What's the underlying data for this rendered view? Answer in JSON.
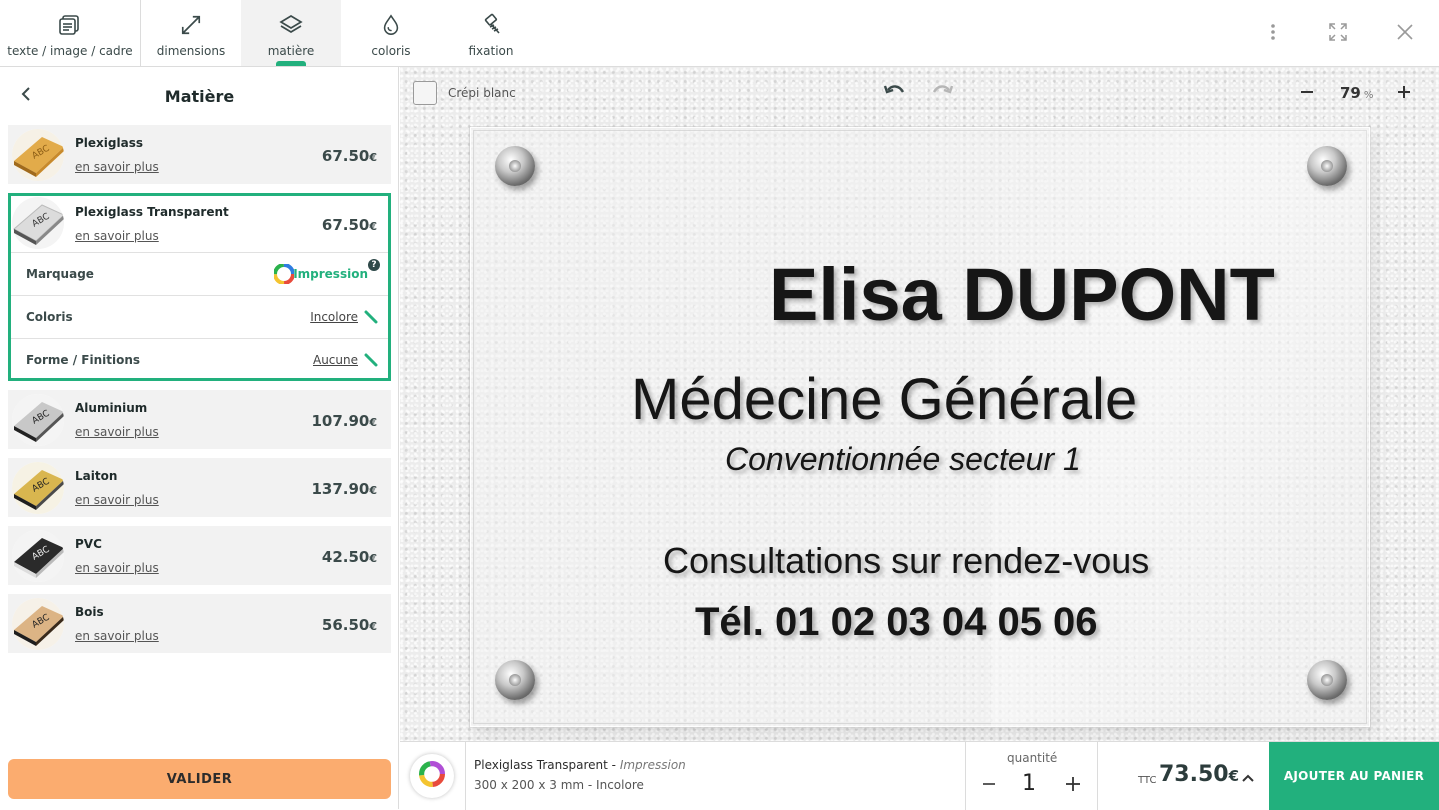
{
  "tabs": [
    {
      "label": "texte / image / cadre",
      "icon": "text-image-frame-icon"
    },
    {
      "label": "dimensions",
      "icon": "resize-arrows-icon"
    },
    {
      "label": "matière",
      "icon": "layers-icon",
      "active": true
    },
    {
      "label": "coloris",
      "icon": "drop-icon"
    },
    {
      "label": "fixation",
      "icon": "screw-icon"
    }
  ],
  "top_right_icons": [
    "more-vertical-icon",
    "fullscreen-icon",
    "close-icon"
  ],
  "panel": {
    "title": "Matière",
    "materials": [
      {
        "name": "Plexiglass",
        "more": "en savoir plus",
        "price": "67.50",
        "currency": "€"
      },
      {
        "name": "Plexiglass Transparent",
        "more": "en savoir plus",
        "price": "67.50",
        "currency": "€",
        "selected": true
      },
      {
        "name": "Aluminium",
        "more": "en savoir plus",
        "price": "107.90",
        "currency": "€"
      },
      {
        "name": "Laiton",
        "more": "en savoir plus",
        "price": "137.90",
        "currency": "€"
      },
      {
        "name": "PVC",
        "more": "en savoir plus",
        "price": "42.50",
        "currency": "€"
      },
      {
        "name": "Bois",
        "more": "en savoir plus",
        "price": "56.50",
        "currency": "€"
      }
    ],
    "options": [
      {
        "label": "Marquage",
        "value": "Impression"
      },
      {
        "label": "Coloris",
        "value": "Incolore"
      },
      {
        "label": "Forme / Finitions",
        "value": "Aucune"
      }
    ],
    "validate": "VALIDER"
  },
  "canvas": {
    "crepi_label": "Crépi blanc",
    "zoom": "79",
    "zoom_unit": "%",
    "plate": {
      "line1_first": "Elisa ",
      "line1_last": "DUPONT",
      "line2": "Médecine Générale",
      "line3": "Conventionnée secteur 1",
      "line4": "Consultations sur rendez-vous",
      "line5": "Tél. 01 02 03 04 05 06"
    }
  },
  "bottom": {
    "product": "Plexiglass Transparent",
    "separator": " - ",
    "marking": "Impression",
    "size": "300 x 200 x 3 mm - Incolore",
    "qty_label": "quantité",
    "qty": "1",
    "ttc": "TTC",
    "total": "73.50",
    "currency": "€",
    "add_to_cart": "AJOUTER AU PANIER"
  },
  "colors": {
    "accent_green": "#22b07d",
    "validate_orange": "#fbac6f",
    "panel_row_bg": "#f2f2f2"
  }
}
